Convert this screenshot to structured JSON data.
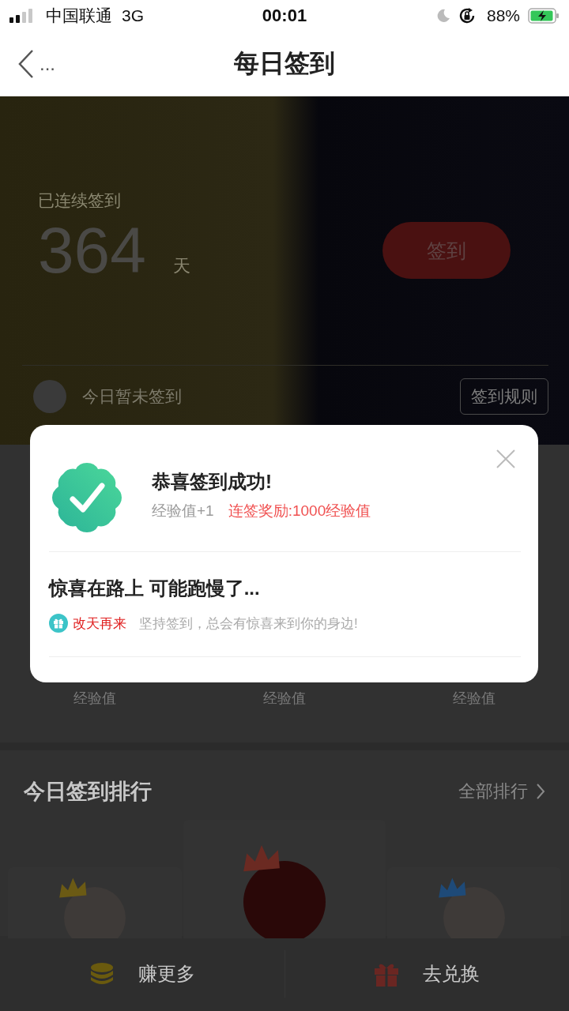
{
  "status_bar": {
    "carrier": "中国联通",
    "network": "3G",
    "time": "00:01",
    "battery": "88%"
  },
  "nav": {
    "more": "...",
    "title": "每日签到"
  },
  "hero": {
    "streak_label": "已连续签到",
    "streak_days": "364",
    "unit": "天",
    "sign_button": "签到",
    "status_text": "今日暂未签到",
    "rules_button": "签到规则"
  },
  "rewards": [
    {
      "label": "经验值"
    },
    {
      "label": "经验值"
    },
    {
      "label": "经验值"
    }
  ],
  "ranking": {
    "title": "今日签到排行",
    "link": "全部排行",
    "podium": [
      {
        "kind": "second",
        "color": "#6b5a14"
      },
      {
        "kind": "first",
        "color": "#6b2a22"
      },
      {
        "kind": "third",
        "color": "#1e4a78"
      }
    ]
  },
  "bottom_bar": [
    {
      "label": "赚更多",
      "kind": "coins"
    },
    {
      "label": "去兑换",
      "kind": "gift"
    }
  ],
  "dialog": {
    "title": "恭喜签到成功!",
    "exp": "经验值+1",
    "bonus": "连签奖励:1000经验值",
    "subtitle": "惊喜在路上 可能跑慢了...",
    "tag": "改天再来",
    "message": "坚持签到，总会有惊喜来到你的身边!"
  }
}
